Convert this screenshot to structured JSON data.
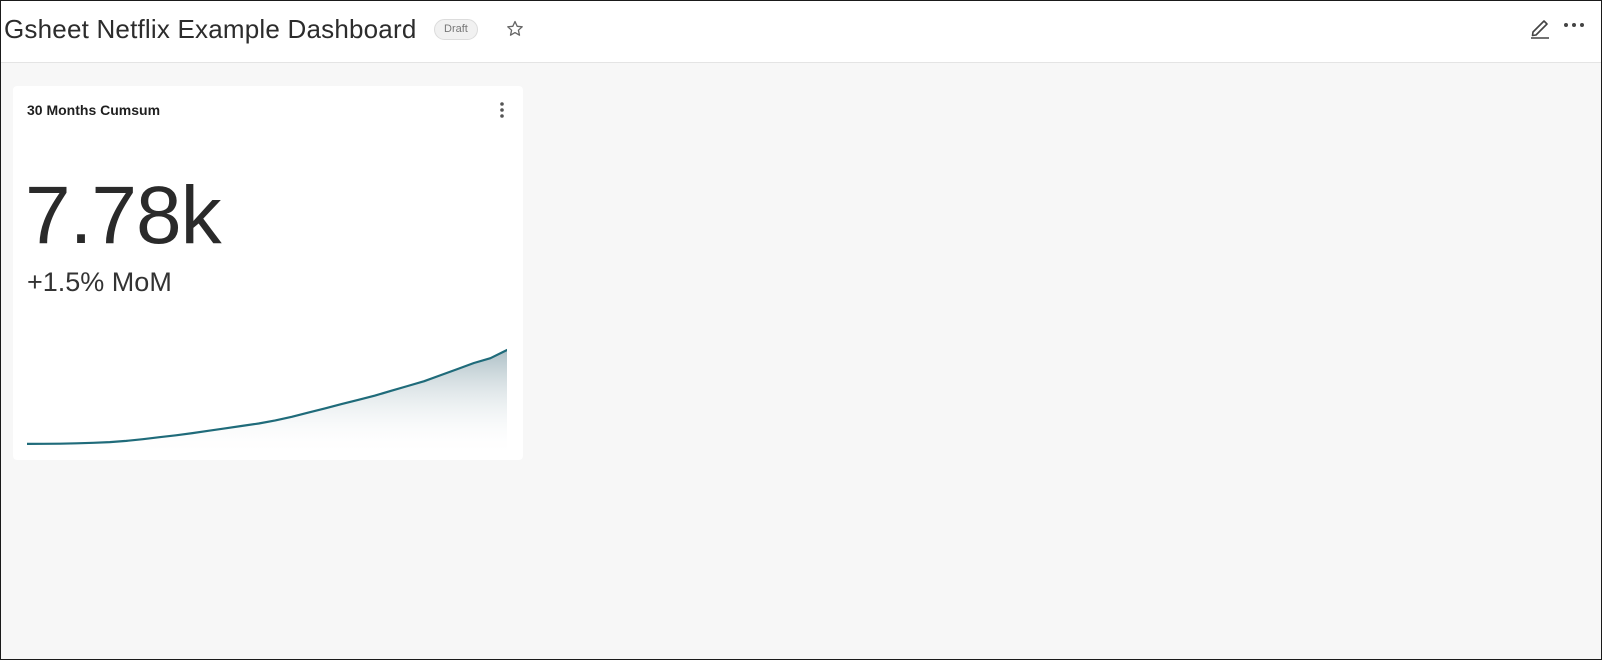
{
  "header": {
    "title": "Gsheet Netflix Example Dashboard",
    "status_badge": "Draft",
    "icons": {
      "favorite": "star-icon",
      "edit": "pencil-icon",
      "more": "more-horizontal-icon"
    }
  },
  "card": {
    "title": "30 Months Cumsum",
    "menu_icon": "more-vertical-icon",
    "big_number": "7.78k",
    "subheader": "+1.5% MoM"
  },
  "colors": {
    "line": "#1f6b7a",
    "area_top": "#9fb5bc",
    "background": "#f7f7f7"
  },
  "chart_data": {
    "type": "area",
    "x": [
      1,
      2,
      3,
      4,
      5,
      6,
      7,
      8,
      9,
      10,
      11,
      12,
      13,
      14,
      15,
      16,
      17,
      18,
      19,
      20,
      21,
      22,
      23,
      24,
      25,
      26,
      27,
      28,
      29,
      30
    ],
    "values": [
      10,
      15,
      25,
      60,
      100,
      160,
      260,
      400,
      560,
      720,
      900,
      1100,
      1300,
      1500,
      1700,
      1950,
      2250,
      2600,
      2950,
      3300,
      3650,
      4000,
      4400,
      4800,
      5200,
      5700,
      6200,
      6700,
      7100,
      7780
    ],
    "grid": false,
    "legend": "none"
  }
}
